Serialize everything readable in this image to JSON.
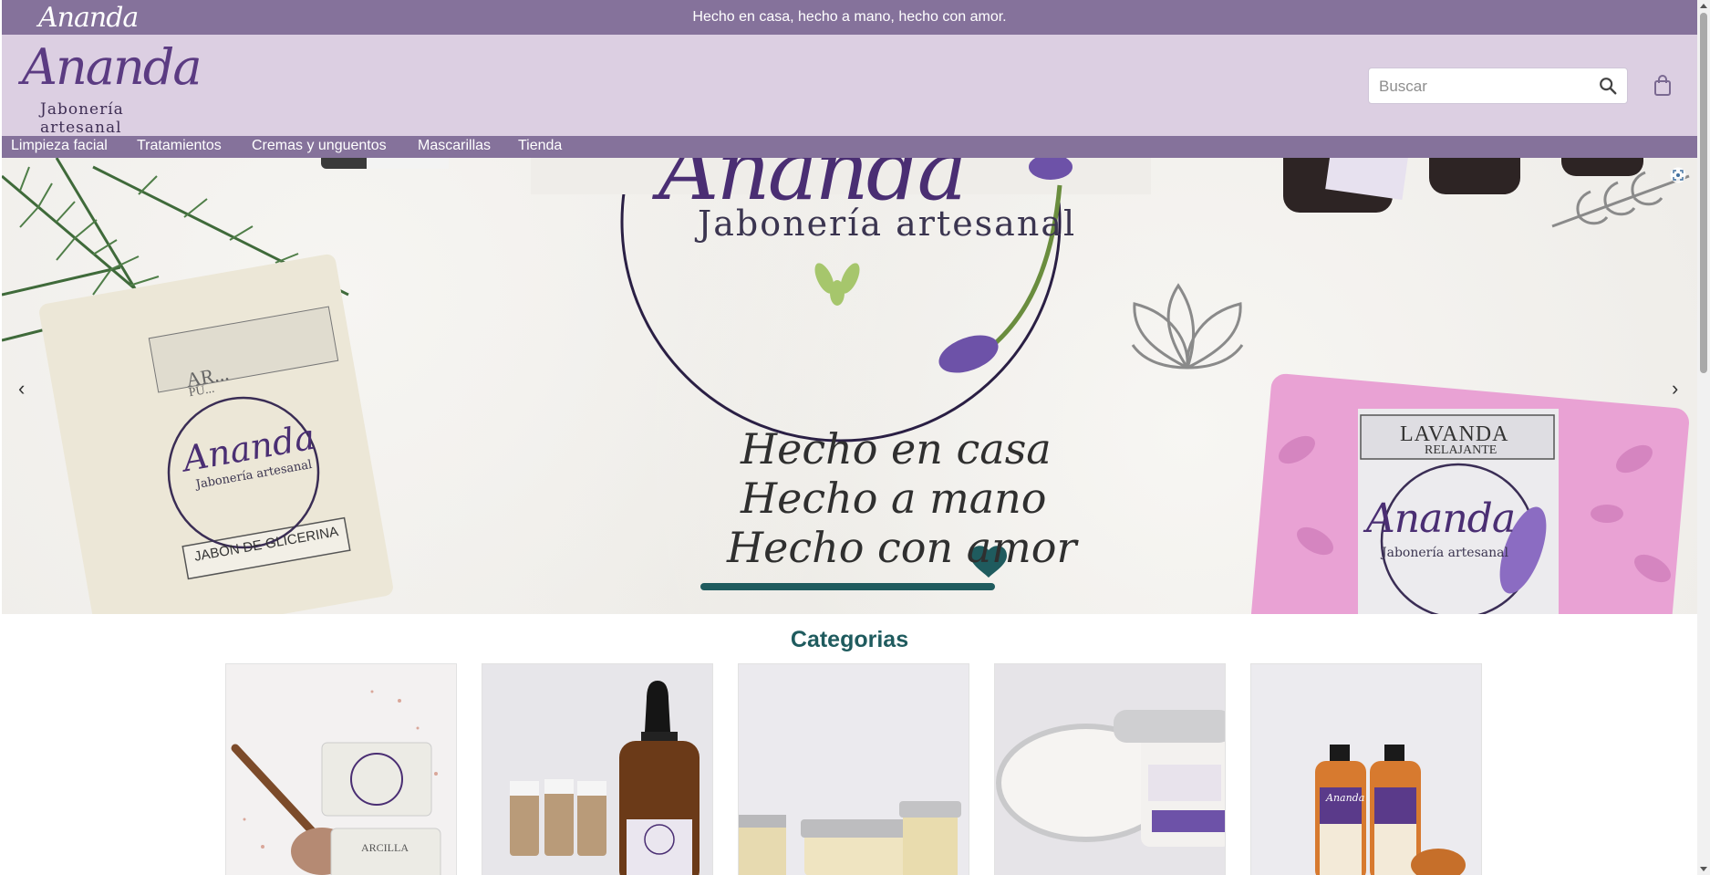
{
  "topbar": {
    "brand": "Ananda",
    "tagline": "Hecho en casa, hecho a mano, hecho con amor."
  },
  "header": {
    "logo_script": "Ananda",
    "logo_sub": "Jabonería artesanal",
    "search_placeholder": "Buscar",
    "icons": [
      "search-icon",
      "shopping-bag-icon"
    ]
  },
  "nav": {
    "items": [
      "Limpieza facial",
      "Tratamientos",
      "Cremas y unguentos",
      "Mascarillas",
      "Tienda"
    ]
  },
  "hero": {
    "logo_script": "Ananda",
    "logo_sub": "Jabonería artesanal",
    "slogan": [
      "Hecho en casa",
      "Hecho a mano",
      "Hecho con amor"
    ],
    "soap_left": {
      "top_label": "AR...",
      "top_label_sub": "PU...",
      "brand": "Ananda",
      "brand_sub": "Jabonería artesanal",
      "label": "JABÓN DE GLICERINA"
    },
    "soap_right": {
      "title": "LAVANDA",
      "subtitle": "RELAJANTE",
      "brand": "Ananda",
      "brand_sub": "Jabonería artesanal"
    },
    "prev_icon": "‹",
    "next_icon": "›",
    "colors": {
      "accent": "#1f5b5e",
      "purple": "#5b3b82",
      "lilac": "#85729b",
      "light_lilac": "#dccfe2"
    }
  },
  "categories": {
    "title": "Categorias",
    "cards": [
      {
        "label": "ARCILLA"
      },
      {
        "label": ""
      },
      {
        "label": ""
      },
      {
        "label": ""
      },
      {
        "label": "Ananda"
      }
    ]
  }
}
